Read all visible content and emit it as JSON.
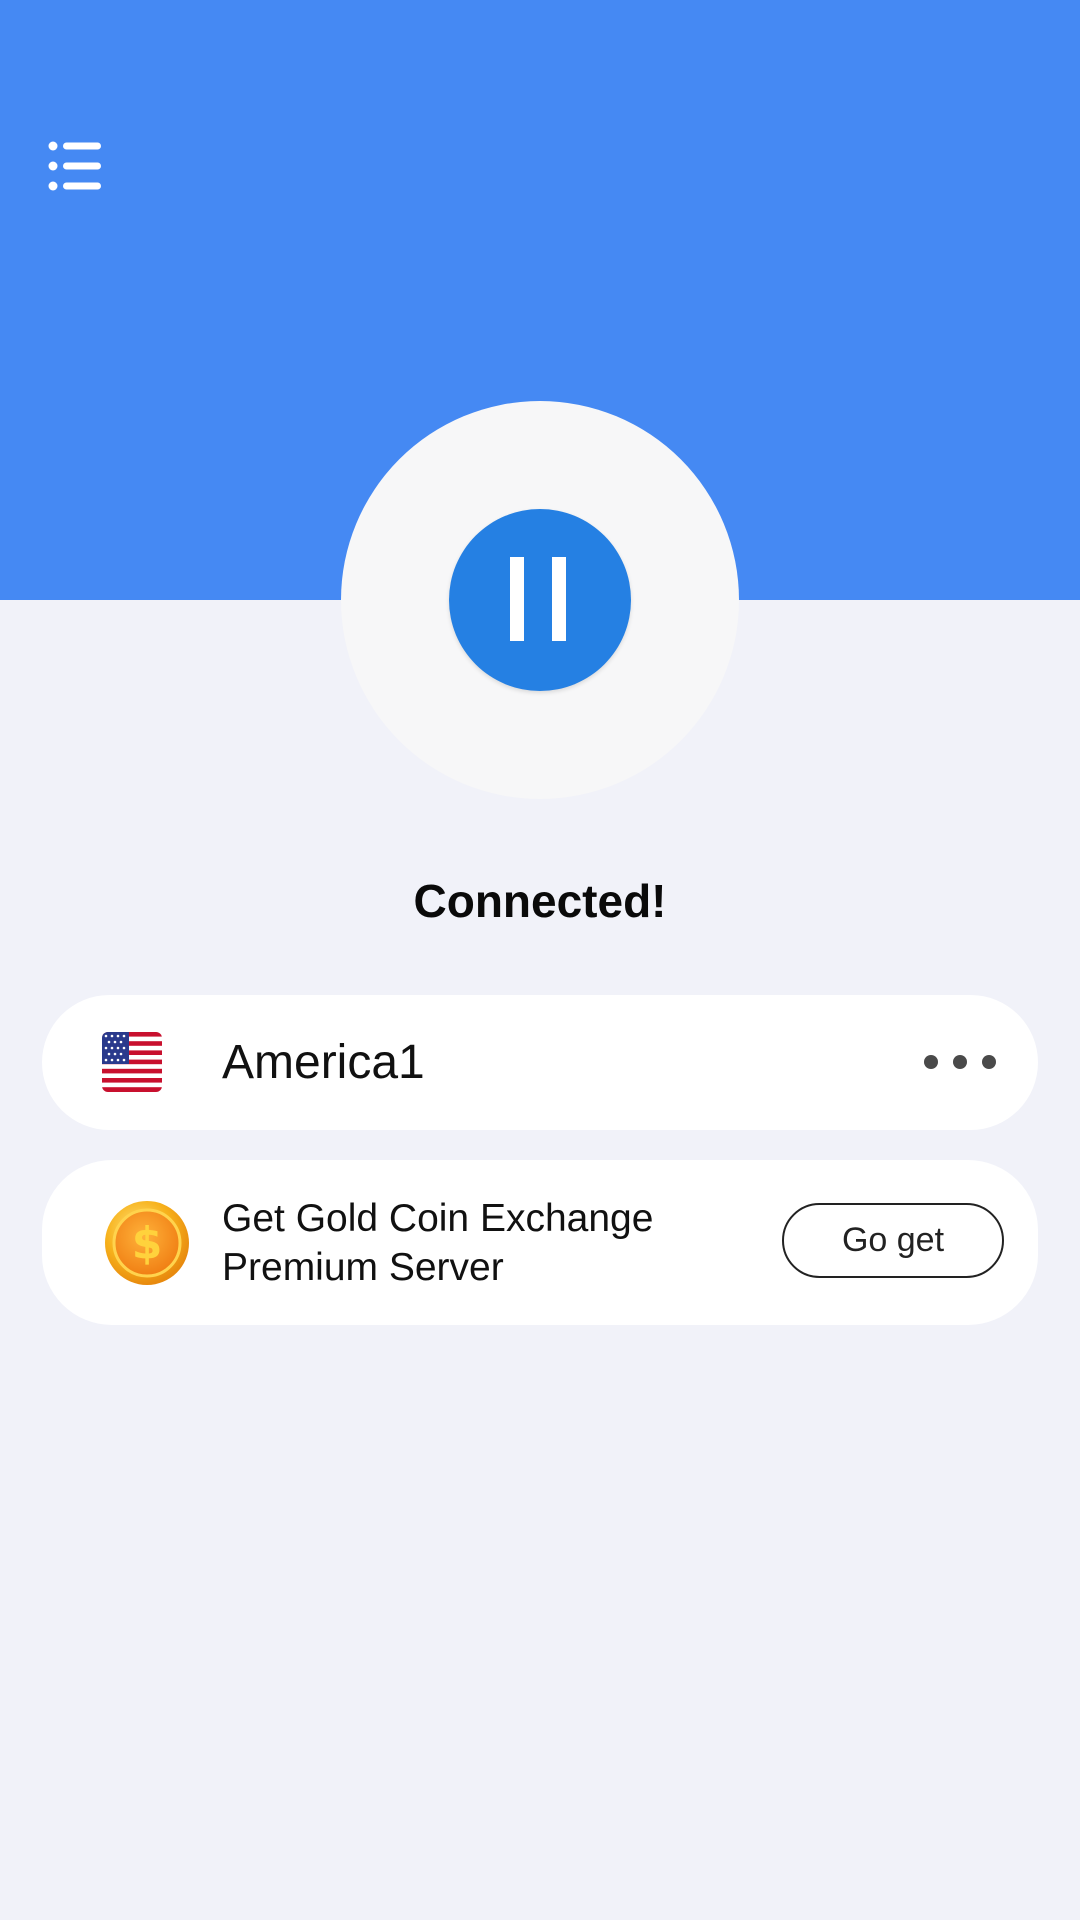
{
  "header": {
    "menu_icon": "list-menu-icon",
    "background_color": "#4589f3"
  },
  "connect_button": {
    "icon": "pause-icon",
    "color": "#2580e3"
  },
  "status": {
    "text": "Connected!"
  },
  "server": {
    "flag_icon": "us-flag-icon",
    "name": "America1",
    "more_icon": "more-dots-icon"
  },
  "promo": {
    "icon": "gold-coin-icon",
    "line1": "Get Gold Coin Exchange",
    "line2": "Premium Server",
    "button_label": "Go get"
  }
}
